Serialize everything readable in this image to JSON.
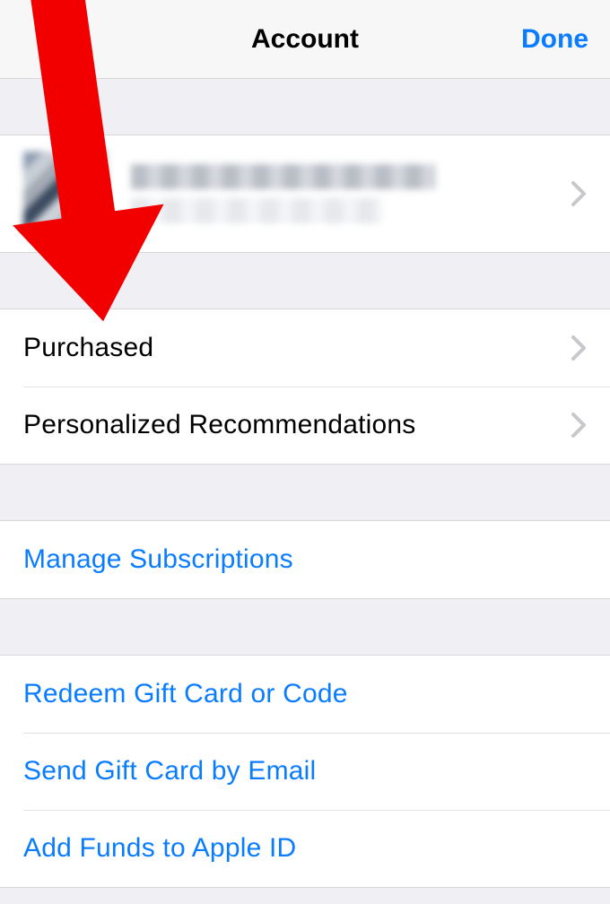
{
  "header": {
    "title": "Account",
    "done": "Done"
  },
  "account_section": {},
  "section2": {
    "purchased": "Purchased",
    "recommendations": "Personalized Recommendations"
  },
  "section3": {
    "manage_subs": "Manage Subscriptions"
  },
  "section4": {
    "redeem": "Redeem Gift Card or Code",
    "send_gift": "Send Gift Card by Email",
    "add_funds": "Add Funds to Apple ID"
  }
}
